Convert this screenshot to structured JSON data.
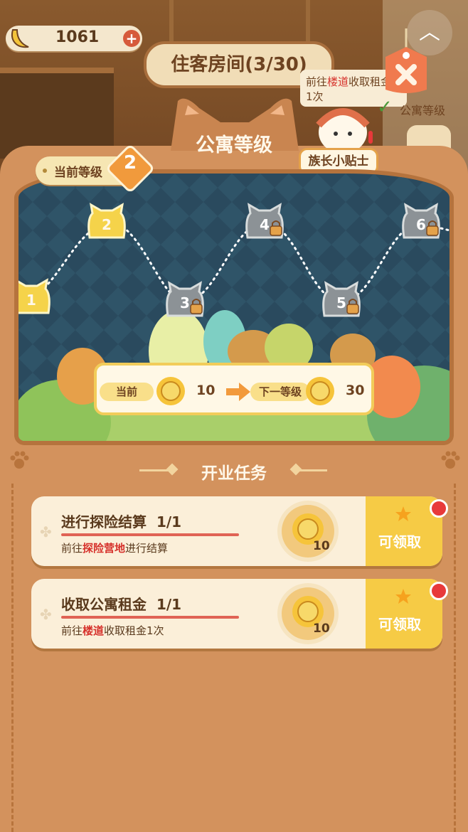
{
  "header": {
    "banana_count": "1061",
    "add_label": "+",
    "room_title": "住客房间(3/30)"
  },
  "side_tip": {
    "text_prefix": "前往",
    "text_highlight": "楼道",
    "text_suffix": "收取租金",
    "count": "1次",
    "right_label": "公寓等级"
  },
  "panel": {
    "title": "公寓等级",
    "current_level_label": "当前等级",
    "current_level_value": "2",
    "tip_button": "族长小贴士"
  },
  "level_map": {
    "nodes": [
      {
        "level": "1",
        "unlocked": true
      },
      {
        "level": "2",
        "unlocked": true
      },
      {
        "level": "3",
        "unlocked": false
      },
      {
        "level": "4",
        "unlocked": false
      },
      {
        "level": "5",
        "unlocked": false
      },
      {
        "level": "6",
        "unlocked": false
      }
    ],
    "current_label": "当前",
    "current_value": "10",
    "next_label": "下一等级",
    "next_value": "30"
  },
  "tasks": {
    "section_title": "开业任务",
    "items": [
      {
        "name": "进行探险结算",
        "progress": "1/1",
        "desc_prefix": "前往",
        "desc_highlight": "探险营地",
        "desc_suffix": "进行结算",
        "reward": "10",
        "claim_label": "可领取"
      },
      {
        "name": "收取公寓租金",
        "progress": "1/1",
        "desc_prefix": "前往",
        "desc_highlight": "楼道",
        "desc_suffix": "收取租金1次",
        "reward": "10",
        "claim_label": "可领取"
      }
    ]
  },
  "colors": {
    "panel": "#d3925d",
    "accent": "#f6cb45",
    "highlight": "#d6312b",
    "map_bg": "#2a4a5e"
  }
}
